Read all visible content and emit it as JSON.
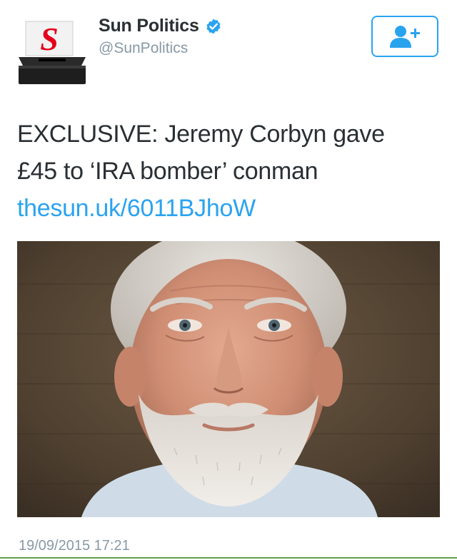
{
  "tweet": {
    "author": {
      "display_name": "Sun Politics",
      "handle": "@SunPolitics",
      "verified": true,
      "avatar_letter": "S",
      "avatar_icon": "ballot-box-logo"
    },
    "follow_icon": "follow-user-plus-icon",
    "text_lines": [
      "EXCLUSIVE: Jeremy Corbyn gave",
      "£45 to ‘IRA bomber’ conman"
    ],
    "link": "thesun.uk/6011BJhoW",
    "media": {
      "kind": "photo",
      "subject": "portrait-photo"
    },
    "timestamp": "19/09/2015 17:21"
  },
  "colors": {
    "text": "#292f33",
    "secondary": "#8899a6",
    "link": "#2aa3ef",
    "logo_red": "#e3001b",
    "divider": "#5e9e4a"
  }
}
